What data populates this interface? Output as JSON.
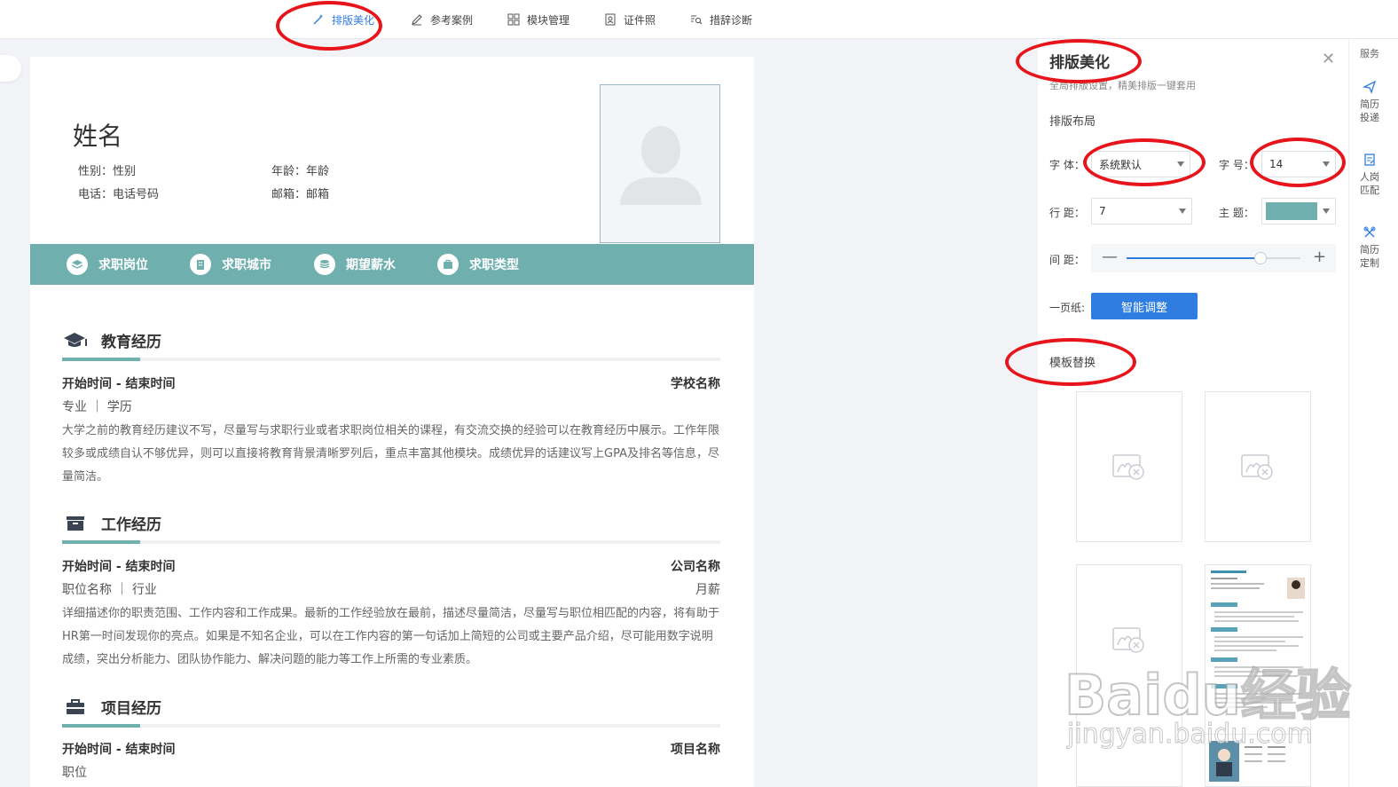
{
  "toolbar": {
    "items": [
      {
        "label": "排版美化",
        "icon": "magic-wand-icon"
      },
      {
        "label": "参考案例",
        "icon": "pen-icon"
      },
      {
        "label": "模块管理",
        "icon": "grid-icon"
      },
      {
        "label": "证件照",
        "icon": "id-photo-icon"
      },
      {
        "label": "措辞诊断",
        "icon": "text-search-icon"
      }
    ]
  },
  "resume": {
    "name": "姓名",
    "gender": "性别：性别",
    "age": "年龄：年龄",
    "phone": "电话：电话号码",
    "email": "邮箱：邮箱",
    "intent": [
      "求职岗位",
      "求职城市",
      "期望薪水",
      "求职类型"
    ],
    "education": {
      "title": "教育经历",
      "period": "开始时间 - 结束时间",
      "org": "学校名称",
      "sub": "专业 ｜ 学历",
      "desc": "大学之前的教育经历建议不写，尽量写与求职行业或者求职岗位相关的课程，有交流交换的经验可以在教育经历中展示。工作年限较多或成绩自认不够优异，则可以直接将教育背景清晰罗列后，重点丰富其他模块。成绩优异的话建议写上GPA及排名等信息，尽量简洁。"
    },
    "work": {
      "title": "工作经历",
      "period": "开始时间 - 结束时间",
      "org": "公司名称",
      "sub": "职位名称 ｜ 行业",
      "salary": "月薪",
      "desc": "详细描述你的职责范围、工作内容和工作成果。最新的工作经验放在最前，描述尽量简洁，尽量写与职位相匹配的内容，将有助于HR第一时间发现你的亮点。如果是不知名企业，可以在工作内容的第一句话加上简短的公司或主要产品介绍，尽可能用数字说明成绩，突出分析能力、团队协作能力、解决问题的能力等工作上所需的专业素质。"
    },
    "project": {
      "title": "项目经历",
      "period": "开始时间 - 结束时间",
      "org": "项目名称",
      "sub": "职位"
    }
  },
  "panel": {
    "title": "排版美化",
    "subtitle": "全局排版设置，精美排版一键套用",
    "layout_title": "排版布局",
    "font_label": "字  体：",
    "font_value": "系统默认",
    "size_label": "字  号：",
    "size_value": "14",
    "line_label": "行  距：",
    "line_value": "7",
    "theme_label": "主  题：",
    "theme_color": "#6fafae",
    "spacing_label": "间  距：",
    "spacing_level": 0.77,
    "onepage_label": "一页纸:",
    "smart_button": "智能调整",
    "template_title": "模板替换"
  },
  "service": {
    "header": "服务",
    "items": [
      {
        "label": "简历投递",
        "icon": "send-icon"
      },
      {
        "label": "人岗匹配",
        "icon": "match-icon"
      },
      {
        "label": "简历定制",
        "icon": "customize-icon"
      }
    ]
  },
  "watermark": {
    "brand": "Baidu经验",
    "url": "jingyan.baidu.com"
  },
  "colors": {
    "accent": "#2f7de1",
    "theme": "#6fafae",
    "annotation": "#e8141c"
  }
}
